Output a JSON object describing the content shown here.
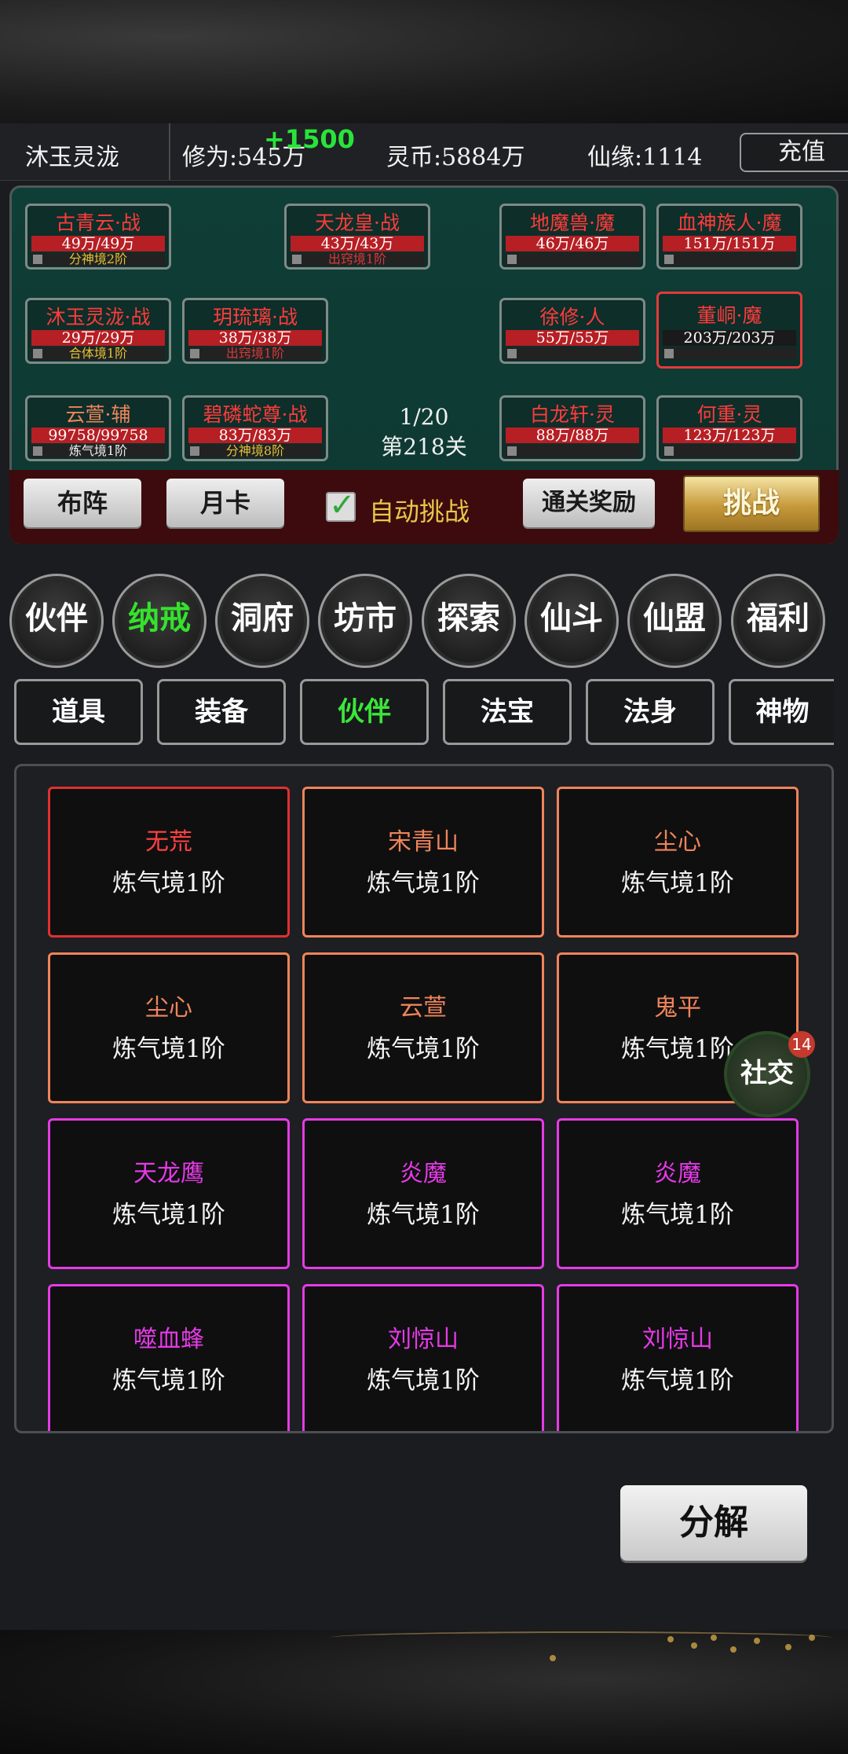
{
  "header": {
    "player_name": "沐玉灵泷",
    "xiuwei": "修为:545万",
    "xiuwei_bonus": "+1500",
    "lingbi": "灵币:5884万",
    "xianyuan": "仙缘:1114",
    "recharge_label": "充值"
  },
  "battle": {
    "allies": [
      {
        "name": "古青云·战",
        "hp": "49万/49万",
        "level": "分神境2阶"
      },
      {
        "name": "天龙皇·战",
        "hp": "43万/43万",
        "level": "出窍境1阶"
      },
      {
        "name": "沐玉灵泷·战",
        "hp": "29万/29万",
        "level": "合体境1阶"
      },
      {
        "name": "玥琉璃·战",
        "hp": "38万/38万",
        "level": "出窍境1阶"
      },
      {
        "name": "云萱·辅",
        "hp": "99758/99758",
        "level": "炼气境1阶"
      },
      {
        "name": "碧磷蛇尊·战",
        "hp": "83万/83万",
        "level": "分神境8阶"
      }
    ],
    "enemies": [
      {
        "name": "地魔兽·魔",
        "hp": "46万/46万"
      },
      {
        "name": "血神族人·魔",
        "hp": "151万/151万"
      },
      {
        "name": "徐修·人",
        "hp": "55万/55万"
      },
      {
        "name": "董峒·魔",
        "hp": "203万/203万"
      },
      {
        "name": "白龙轩·灵",
        "hp": "88万/88万"
      },
      {
        "name": "何重·灵",
        "hp": "123万/123万"
      }
    ],
    "wave": "1/20",
    "stage": "第218关",
    "formation_label": "布阵",
    "monthly_card_label": "月卡",
    "auto_label": "自动挑战",
    "auto_checked": true,
    "reward_label": "通关奖励",
    "challenge_label": "挑战"
  },
  "nav": [
    "伙伴",
    "纳戒",
    "洞府",
    "坊市",
    "探索",
    "仙斗",
    "仙盟",
    "福利"
  ],
  "nav_active": "纳戒",
  "tabs": [
    "道具",
    "装备",
    "伙伴",
    "法宝",
    "法身",
    "神物"
  ],
  "tab_active": "伙伴",
  "colors": {
    "red": "#ff3b3b",
    "orange": "#f0845a",
    "purple": "#e63ae6",
    "active_green": "#35e12d"
  },
  "cards": [
    {
      "name": "无荒",
      "level": "炼气境1阶",
      "rarity": "red"
    },
    {
      "name": "宋青山",
      "level": "炼气境1阶",
      "rarity": "orange"
    },
    {
      "name": "尘心",
      "level": "炼气境1阶",
      "rarity": "orange"
    },
    {
      "name": "尘心",
      "level": "炼气境1阶",
      "rarity": "orange"
    },
    {
      "name": "云萱",
      "level": "炼气境1阶",
      "rarity": "orange"
    },
    {
      "name": "鬼平",
      "level": "炼气境1阶",
      "rarity": "orange"
    },
    {
      "name": "天龙鹰",
      "level": "炼气境1阶",
      "rarity": "purple"
    },
    {
      "name": "炎魔",
      "level": "炼气境1阶",
      "rarity": "purple"
    },
    {
      "name": "炎魔",
      "level": "炼气境1阶",
      "rarity": "purple"
    },
    {
      "name": "噬血蜂",
      "level": "炼气境1阶",
      "rarity": "purple"
    },
    {
      "name": "刘惊山",
      "level": "炼气境1阶",
      "rarity": "purple"
    },
    {
      "name": "刘惊山",
      "level": "炼气境1阶",
      "rarity": "purple"
    }
  ],
  "social": {
    "label": "社交",
    "badge": "14"
  },
  "decompose_label": "分解"
}
